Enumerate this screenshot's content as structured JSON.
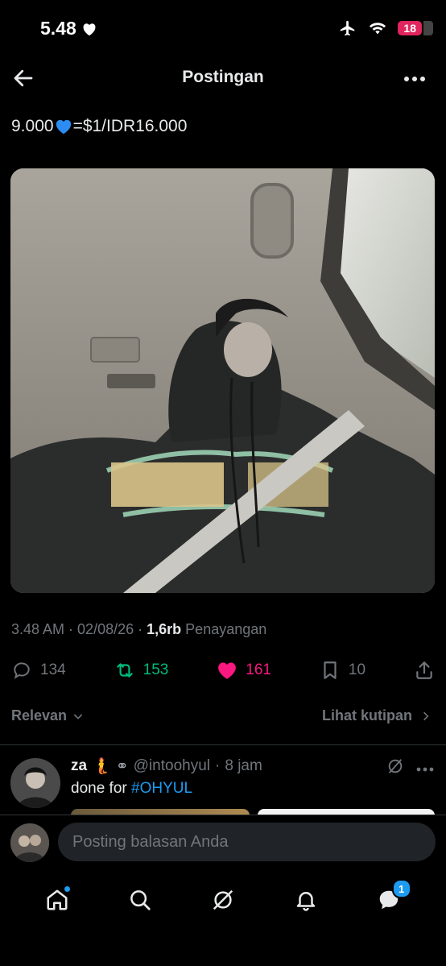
{
  "status": {
    "time": "5.48",
    "battery": "18"
  },
  "header": {
    "title": "Postingan"
  },
  "post": {
    "text_before": "9.000",
    "text_after": "=$1/IDR16.000",
    "time": "3.48 AM",
    "date": "02/08/26",
    "views_count": "1,6rb",
    "views_label": "Penayangan",
    "replies": "134",
    "reposts": "153",
    "likes": "161",
    "bookmarks": "10"
  },
  "sort": {
    "label": "Relevan",
    "quotes_label": "Lihat kutipan"
  },
  "reply": {
    "name": "za",
    "handle": "@intoohyul",
    "age": "8 jam",
    "text_before": "done for ",
    "hashtag": "#OHYUL"
  },
  "composer": {
    "placeholder": "Posting balasan Anda"
  },
  "nav": {
    "messages_badge": "1"
  },
  "colors": {
    "accent": "#1d9bf0",
    "repost": "#00ba7c",
    "like": "#f91880",
    "muted": "#71767b"
  }
}
